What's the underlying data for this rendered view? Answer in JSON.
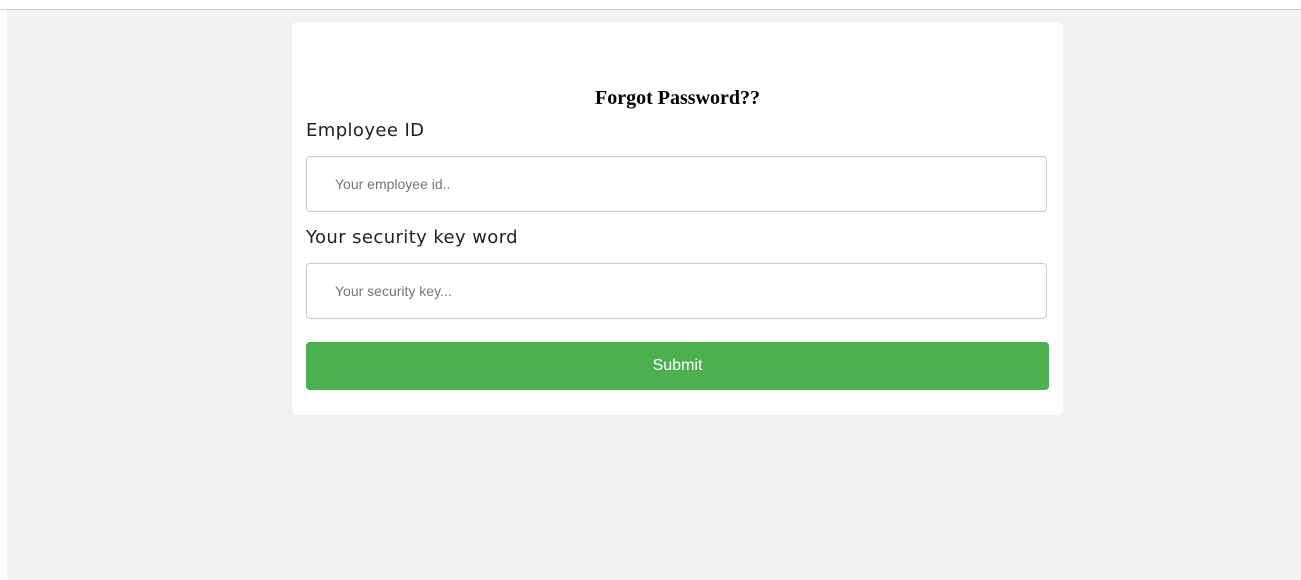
{
  "form": {
    "title": "Forgot Password??",
    "employee_id": {
      "label": "Employee ID",
      "value": "",
      "placeholder": "Your employee id.."
    },
    "security_key": {
      "label": "Your security key word",
      "value": "",
      "placeholder": "Your security key..."
    },
    "submit_label": "Submit"
  },
  "colors": {
    "background": "#f2f2f2",
    "card": "#ffffff",
    "submit_button": "#4caf50",
    "submit_text": "#ffffff"
  }
}
